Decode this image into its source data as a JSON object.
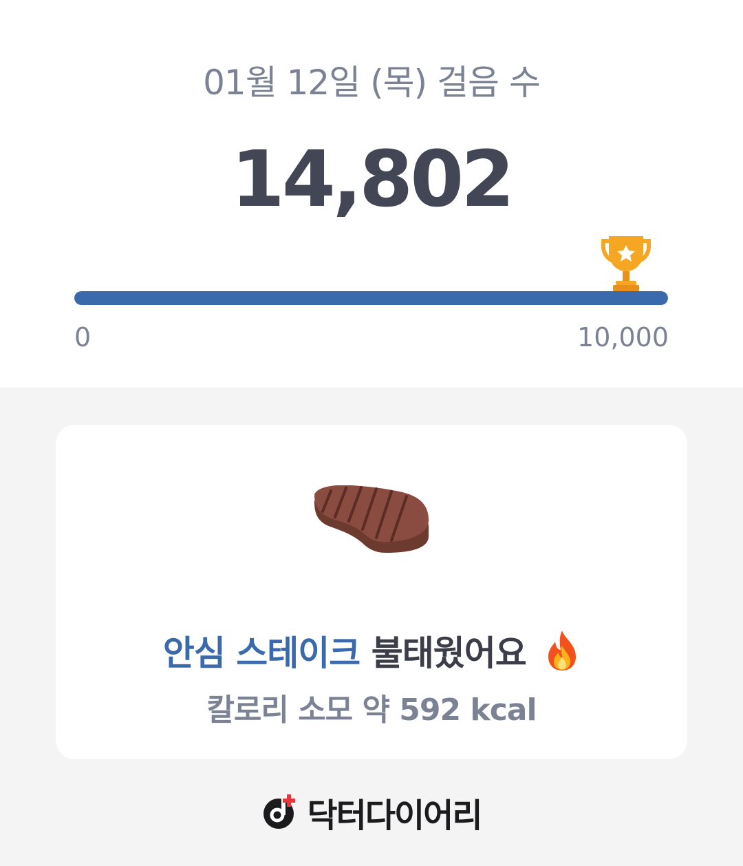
{
  "header": {
    "date_title": "01월 12일 (목) 걸음 수",
    "steps": "14,802"
  },
  "progress": {
    "min_label": "0",
    "max_label": "10,000",
    "fill_fraction": 1.0,
    "goal_icon": "trophy-icon",
    "fill_color": "#3a6aab",
    "trophy_color": "#f5a623"
  },
  "card": {
    "illustration_icon": "steak-icon",
    "food_name": "안심 스테이크",
    "burn_text": "불태웠어요",
    "burn_icon": "fire-icon",
    "calorie_text": "칼로리 소모 약 592 kcal"
  },
  "brand": {
    "logo_icon": "doctor-diary-logo-icon",
    "name": "닥터다이어리"
  }
}
